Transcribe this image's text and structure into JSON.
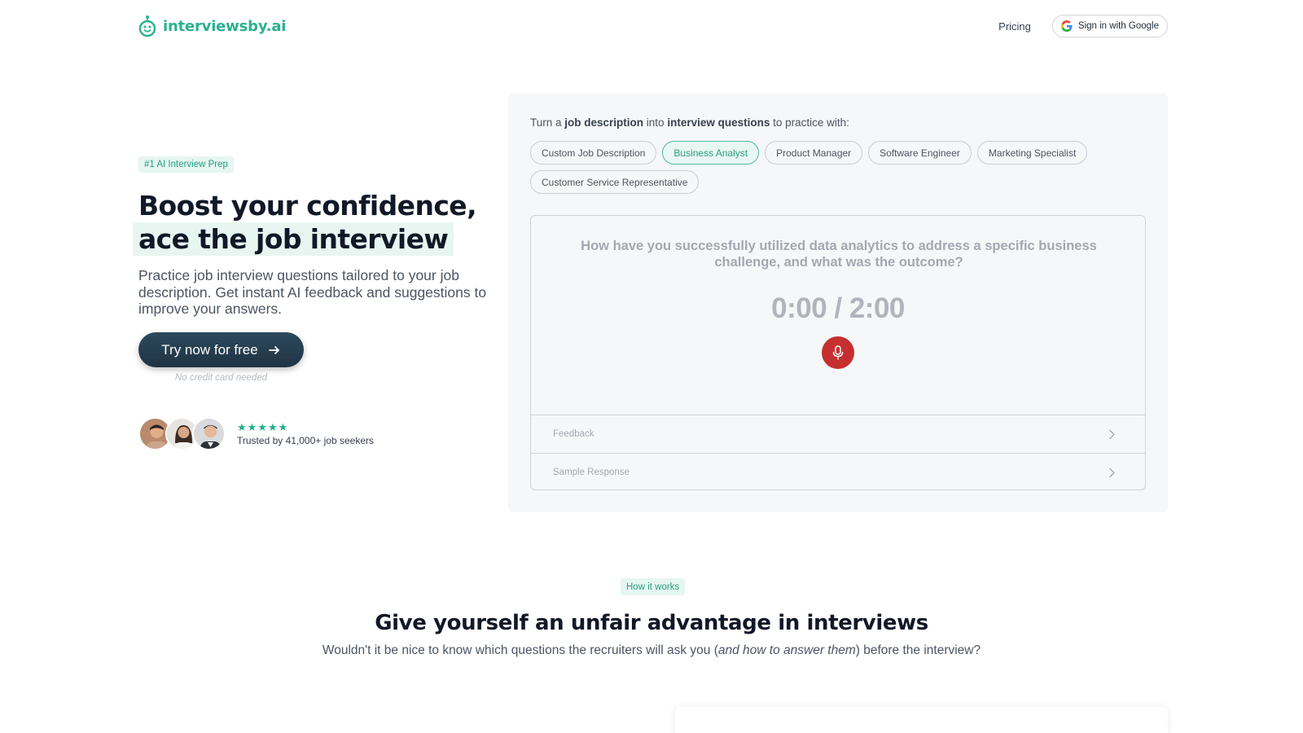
{
  "header": {
    "brand_name": "interviewsby.ai",
    "nav_pricing": "Pricing",
    "sign_in_label": "Sign in with Google"
  },
  "hero": {
    "badge": "#1 AI Interview Prep",
    "headline_line1": "Boost your confidence,",
    "headline_line2": "ace the job interview",
    "subtext": "Practice job interview questions tailored to your job description. Get instant AI feedback and suggestions to improve your answers.",
    "cta_label": "Try now for free",
    "cta_note": "No credit card needed",
    "rating_stars": 5,
    "trust_text": "Trusted by 41,000+ job seekers"
  },
  "demo": {
    "title_prefix": "Turn a ",
    "title_bold1": "job description",
    "title_mid": " into ",
    "title_bold2": "interview questions",
    "title_suffix": " to practice with:",
    "pills": [
      {
        "label": "Custom Job Description",
        "active": false
      },
      {
        "label": "Business Analyst",
        "active": true
      },
      {
        "label": "Product Manager",
        "active": false
      },
      {
        "label": "Software Engineer",
        "active": false
      },
      {
        "label": "Marketing Specialist",
        "active": false
      },
      {
        "label": "Customer Service Representative",
        "active": false
      }
    ],
    "question": "How have you successfully utilized data analytics to address a specific business challenge, and what was the outcome?",
    "timer": "0:00 / 2:00",
    "feedback_label": "Feedback",
    "sample_label": "Sample Response"
  },
  "how": {
    "badge": "How it works",
    "title": "Give yourself an unfair advantage in interviews",
    "sub_before": "Wouldn't it be nice to know which questions the recruiters will ask you (",
    "sub_italic": "and how to answer them",
    "sub_after": ") before the interview?"
  },
  "colors": {
    "brand": "#2bb192",
    "cta_bg": "#1f3344",
    "mic": "#c62f2f",
    "star": "#1fae8b"
  }
}
